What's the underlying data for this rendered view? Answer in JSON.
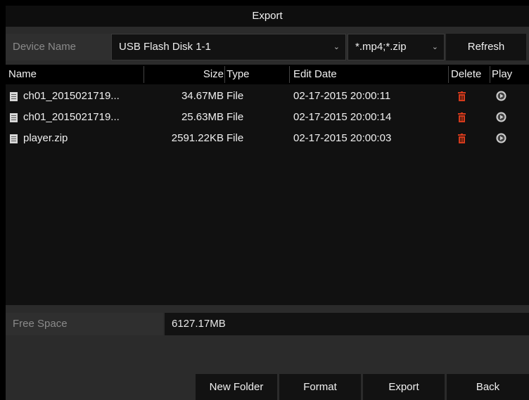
{
  "window": {
    "title": "Export"
  },
  "device": {
    "label": "Device Name",
    "selected": "USB Flash Disk 1-1",
    "filter": "*.mp4;*.zip",
    "refresh_label": "Refresh",
    "dropdown_icon": "chevron-down-icon"
  },
  "table": {
    "headers": {
      "name": "Name",
      "size": "Size",
      "type": "Type",
      "edit_date": "Edit Date",
      "delete": "Delete",
      "play": "Play"
    },
    "rows": [
      {
        "name": "ch01_2015021719...",
        "size": "34.67MB",
        "type": "File",
        "edit_date": "02-17-2015 20:00:11"
      },
      {
        "name": "ch01_2015021719...",
        "size": "25.63MB",
        "type": "File",
        "edit_date": "02-17-2015 20:00:14"
      },
      {
        "name": "player.zip",
        "size": "2591.22KB",
        "type": "File",
        "edit_date": "02-17-2015 20:00:03"
      }
    ],
    "delete_color": "#d43a1c",
    "play_color": "#cfcfcf"
  },
  "free_space": {
    "label": "Free Space",
    "value": "6127.17MB"
  },
  "footer": {
    "new_folder": "New Folder",
    "format": "Format",
    "export": "Export",
    "back": "Back"
  }
}
